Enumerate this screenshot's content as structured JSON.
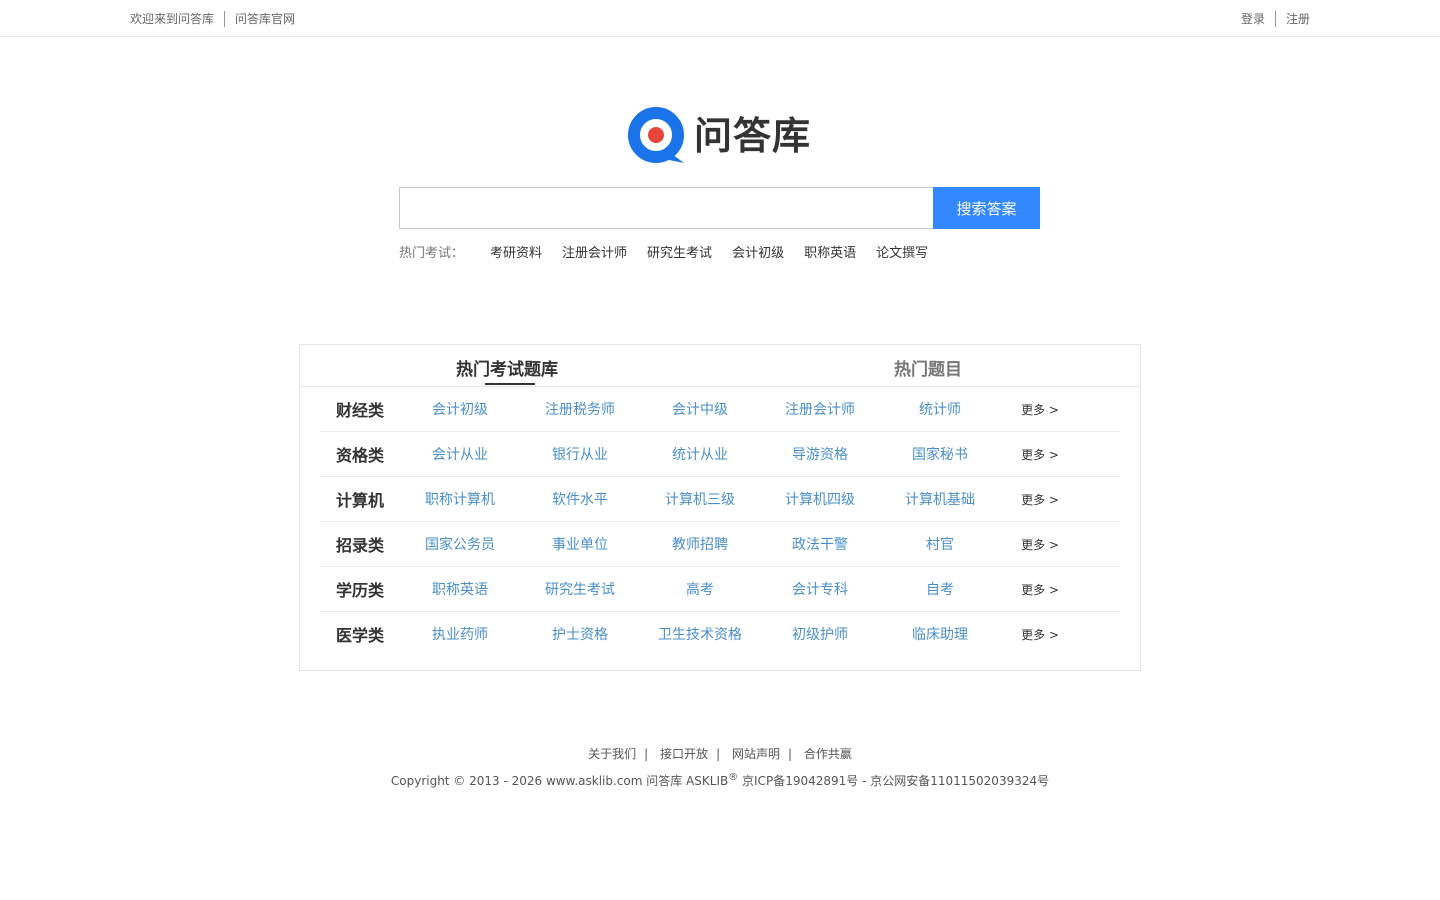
{
  "topbar": {
    "welcome": "欢迎来到问答库",
    "official_site": "问答库官网",
    "login": "登录",
    "register": "注册"
  },
  "logo": {
    "text": "问答库",
    "colors": {
      "ring": "#1a73e8",
      "dot": "#e8453c"
    }
  },
  "search": {
    "placeholder": "",
    "value": "",
    "button": "搜索答案",
    "accent": "#3388ff"
  },
  "hot_exams": {
    "label": "热门考试：",
    "items": [
      "考研资料",
      "注册会计师",
      "研究生考试",
      "会计初级",
      "职称英语",
      "论文撰写"
    ]
  },
  "panel": {
    "tabs": [
      "热门考试题库",
      "热门题目"
    ],
    "more": "更多 >",
    "link_color": "#4a8fc9",
    "rows": [
      {
        "category": "财经类",
        "links": [
          "会计初级",
          "注册税务师",
          "会计中级",
          "注册会计师",
          "统计师"
        ]
      },
      {
        "category": "资格类",
        "links": [
          "会计从业",
          "银行从业",
          "统计从业",
          "导游资格",
          "国家秘书"
        ]
      },
      {
        "category": "计算机",
        "links": [
          "职称计算机",
          "软件水平",
          "计算机三级",
          "计算机四级",
          "计算机基础"
        ]
      },
      {
        "category": "招录类",
        "links": [
          "国家公务员",
          "事业单位",
          "教师招聘",
          "政法干警",
          "村官"
        ]
      },
      {
        "category": "学历类",
        "links": [
          "职称英语",
          "研究生考试",
          "高考",
          "会计专科",
          "自考"
        ]
      },
      {
        "category": "医学类",
        "links": [
          "执业药师",
          "护士资格",
          "卫生技术资格",
          "初级护师",
          "临床助理"
        ]
      }
    ]
  },
  "footer": {
    "links": [
      "关于我们",
      "接口开放",
      "网站声明",
      "合作共赢"
    ],
    "copyright_pre": "Copyright © 2013 - 2026 www.asklib.com  问答库  ASKLIB",
    "registered": "®",
    "copyright_post": " 京ICP备19042891号 - 京公网安备11011502039324号"
  }
}
